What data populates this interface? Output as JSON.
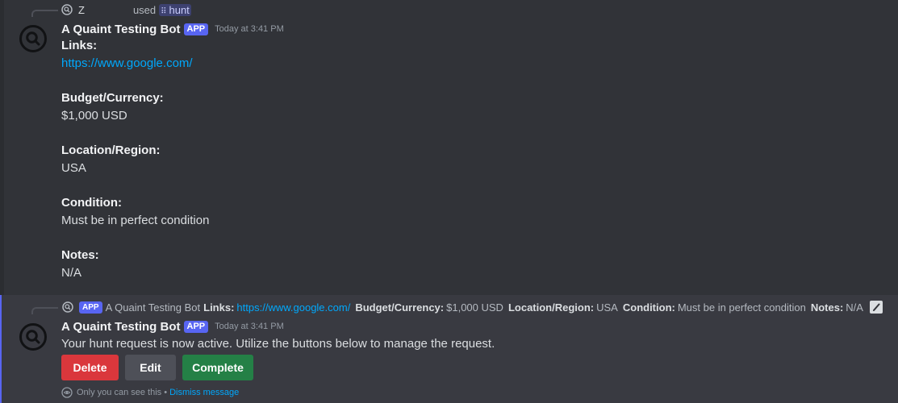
{
  "message1": {
    "reply": {
      "user": "Z",
      "used_text": "used",
      "command_glyph": "⠿",
      "command": "hunt"
    },
    "author": "A Quaint Testing Bot",
    "app_tag": "APP",
    "timestamp": "Today at 3:41 PM",
    "fields": [
      {
        "label": "Links:",
        "value": "https://www.google.com/"
      },
      {
        "label": "Budget/Currency:",
        "value": "$1,000 USD"
      },
      {
        "label": "Location/Region:",
        "value": "USA"
      },
      {
        "label": "Condition:",
        "value": "Must be in perfect condition"
      },
      {
        "label": "Notes:",
        "value": "N/A"
      }
    ]
  },
  "message2": {
    "reply": {
      "app_tag": "APP",
      "author": "A Quaint Testing Bot",
      "links_label": "Links:",
      "links_value": "https://www.google.com/",
      "budget_label": "Budget/Currency:",
      "budget_value": "$1,000 USD",
      "location_label": "Location/Region:",
      "location_value": "USA",
      "condition_label": "Condition:",
      "condition_value": "Must be in perfect condition",
      "notes_label": "Notes:",
      "notes_value": "N/A"
    },
    "author": "A Quaint Testing Bot",
    "app_tag": "APP",
    "timestamp": "Today at 3:41 PM",
    "content": "Your hunt request is now active. Utilize the buttons below to manage the request.",
    "buttons": {
      "delete": "Delete",
      "edit": "Edit",
      "complete": "Complete"
    },
    "ephemeral": {
      "text": "Only you can see this •",
      "dismiss": "Dismiss message"
    }
  },
  "colors": {
    "background": "#313338",
    "highlight": "#393a41",
    "accent": "#5865f2",
    "link": "#00a8fc",
    "danger": "#da373c",
    "success": "#248046",
    "secondary": "#4e5058"
  },
  "icons": {
    "avatar": "magnifier-avatar-icon",
    "reply_avatar": "magnifier-mini-icon",
    "edit": "pencil-icon",
    "ephemeral": "eye-icon"
  }
}
